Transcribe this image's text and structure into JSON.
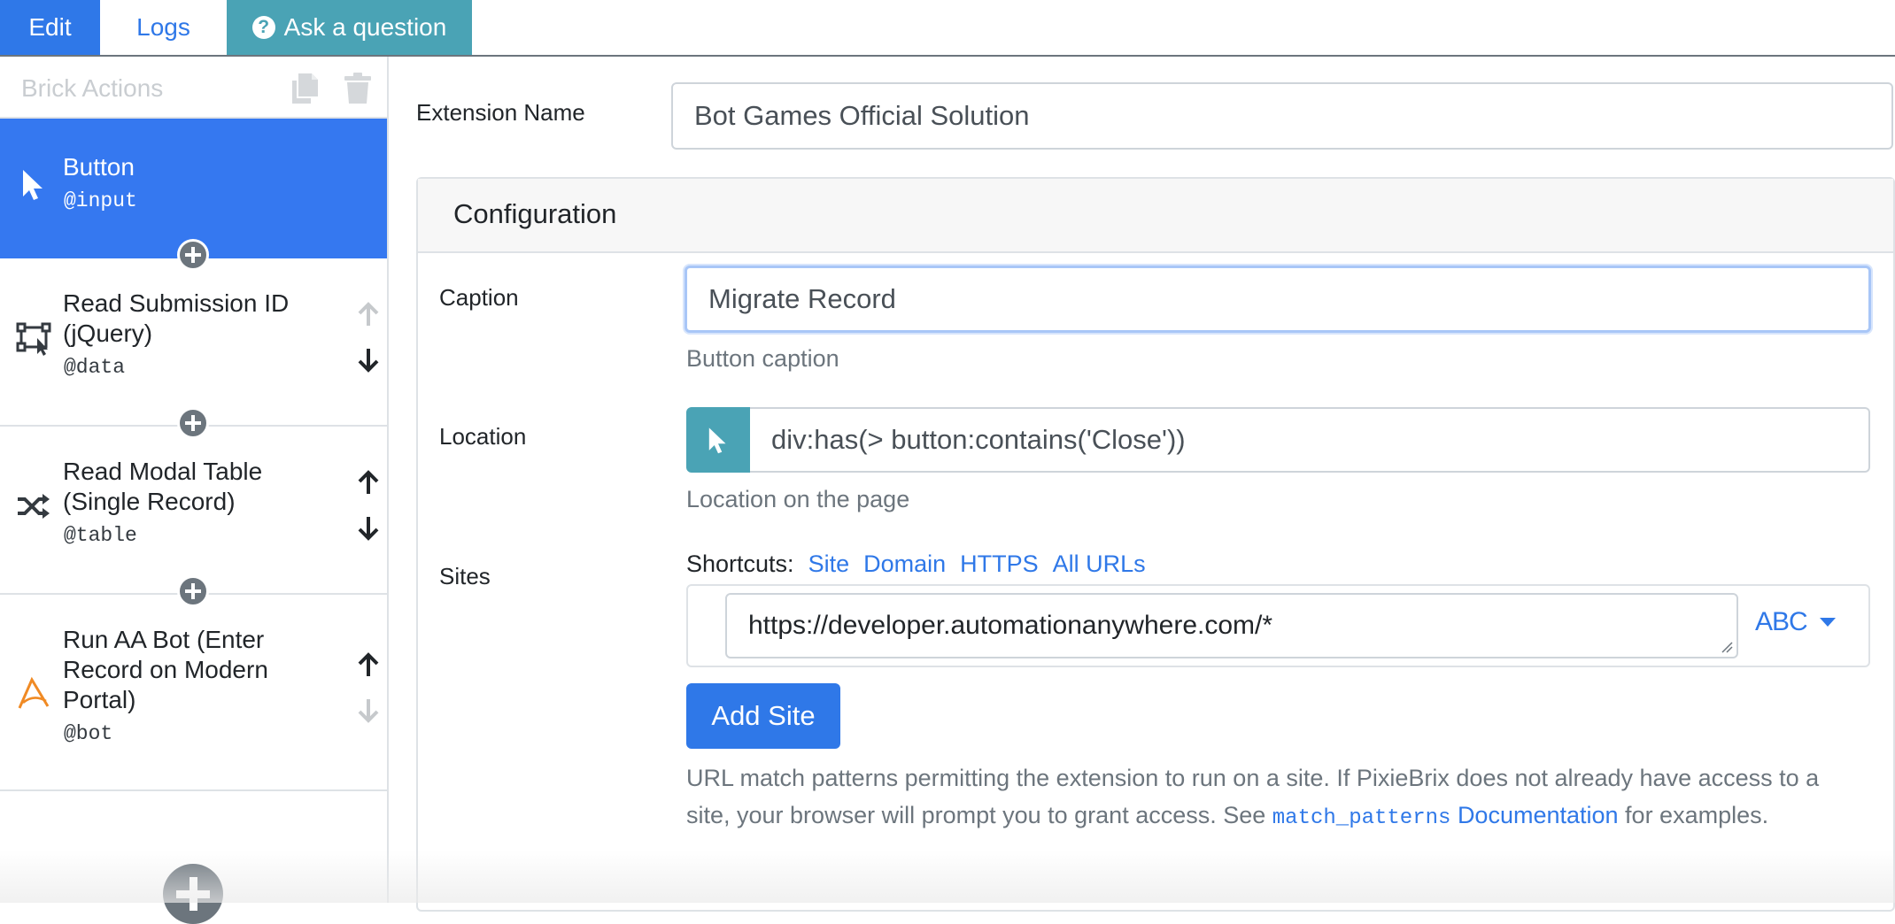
{
  "tabs": {
    "edit": "Edit",
    "logs": "Logs",
    "ask": "Ask a question"
  },
  "sidebar": {
    "title": "Brick Actions",
    "bricks": [
      {
        "name": "Button",
        "var": "@input",
        "icon": "cursor-icon",
        "active": true
      },
      {
        "name": "Read Submission ID (jQuery)",
        "var": "@data",
        "icon": "selector-icon"
      },
      {
        "name": "Read Modal Table (Single Record)",
        "var": "@table",
        "icon": "shuffle-icon"
      },
      {
        "name": "Run AA Bot (Enter Record on Modern Portal)",
        "var": "@bot",
        "icon": "automation-anywhere-icon"
      }
    ]
  },
  "form": {
    "extension_name_label": "Extension Name",
    "extension_name_value": "Bot Games Official Solution",
    "configuration_title": "Configuration",
    "caption_label": "Caption",
    "caption_value": "Migrate Record",
    "caption_help": "Button caption",
    "location_label": "Location",
    "location_value": "div:has(> button:contains('Close'))",
    "location_help": "Location on the page",
    "sites_label": "Sites",
    "shortcuts_label": "Shortcuts:",
    "shortcuts": [
      "Site",
      "Domain",
      "HTTPS",
      "All URLs"
    ],
    "site_value": "https://developer.automationanywhere.com/*",
    "type_toggle": "ABC",
    "add_site": "Add Site",
    "sites_help_1": "URL match patterns permitting the extension to run on a site. If PixieBrix does not already have access to a site, your browser will prompt you to grant access. See ",
    "sites_help_code": "match_patterns",
    "sites_help_link": "Documentation",
    "sites_help_2": " for examples."
  },
  "colors": {
    "primary": "#2f78e8",
    "info": "#4aa3b5",
    "active_brick": "#3578f0"
  }
}
